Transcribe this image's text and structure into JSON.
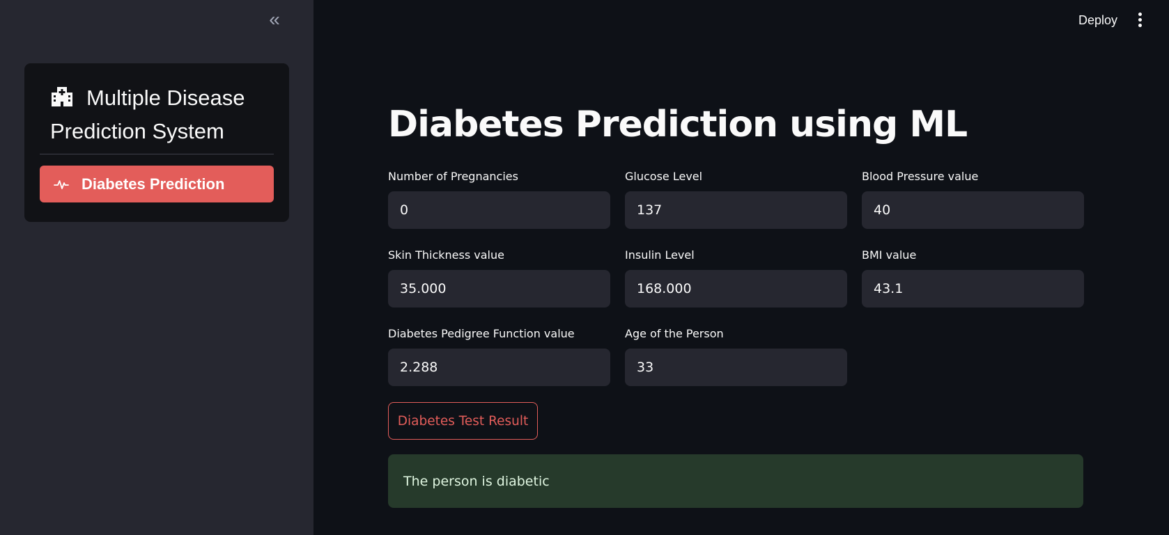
{
  "sidebar": {
    "collapse_glyph": "«",
    "menu": {
      "title": "Multiple Disease Prediction System",
      "title_icon": "hospital-icon",
      "items": [
        {
          "label": "Diabetes Prediction",
          "icon": "activity-pulse-icon",
          "selected": true
        }
      ]
    }
  },
  "header": {
    "deploy_label": "Deploy",
    "more_icon": "kebab-menu-icon"
  },
  "main": {
    "title": "Diabetes Prediction using ML",
    "fields": [
      {
        "label": "Number of Pregnancies",
        "value": "0"
      },
      {
        "label": "Glucose Level",
        "value": "137"
      },
      {
        "label": "Blood Pressure value",
        "value": "40"
      },
      {
        "label": "Skin Thickness value",
        "value": "35.000"
      },
      {
        "label": "Insulin Level",
        "value": "168.000"
      },
      {
        "label": "BMI value",
        "value": "43.1"
      },
      {
        "label": "Diabetes Pedigree Function value",
        "value": "2.288"
      },
      {
        "label": "Age of the Person",
        "value": "33"
      }
    ],
    "submit_label": "Diabetes Test Result",
    "result_message": "The person is diabetic"
  },
  "colors": {
    "accent": "#e35d5a",
    "background": "#0e1117",
    "sidebar": "#262730",
    "success_bg": "#263a2b"
  }
}
